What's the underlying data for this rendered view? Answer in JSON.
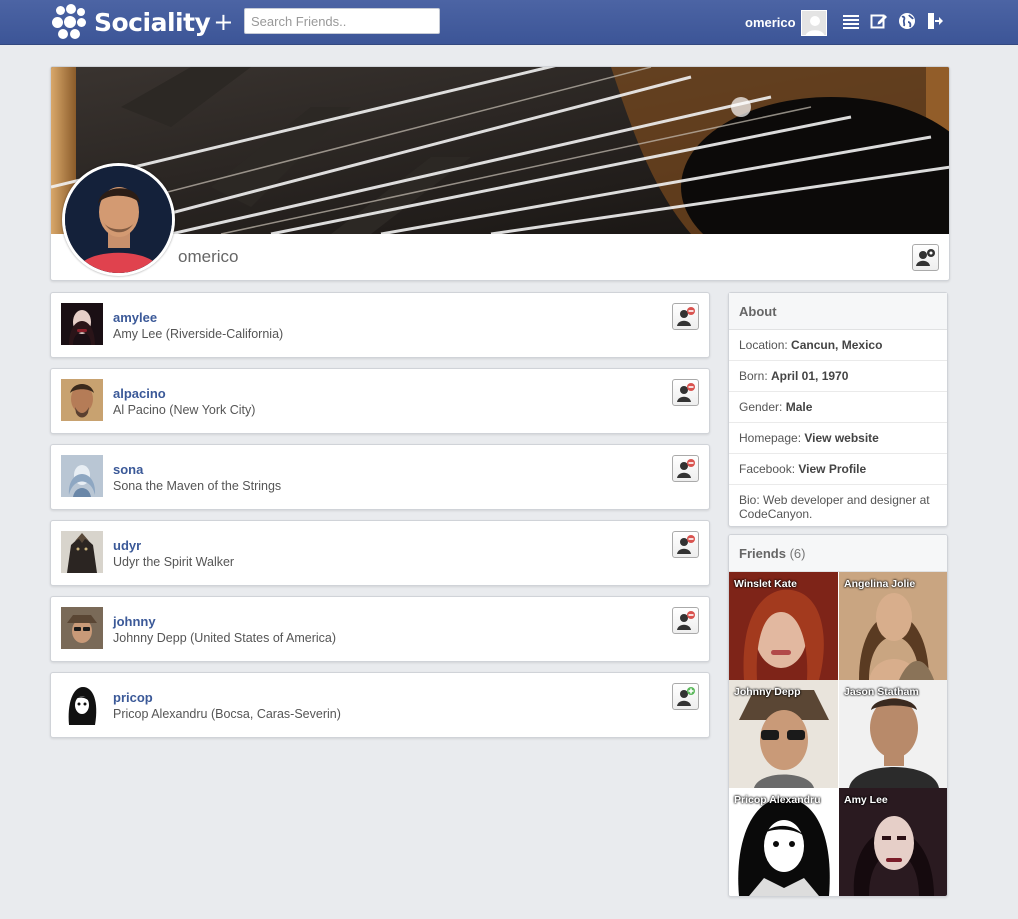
{
  "header": {
    "brand": "Sociality",
    "brand_plus": "+",
    "search_placeholder": "Search Friends..",
    "username": "omerico",
    "icons": [
      "list-icon",
      "edit-icon",
      "globe-icon",
      "logout-icon"
    ]
  },
  "profile": {
    "name": "omerico",
    "settings_icon": "user-gear-icon"
  },
  "friends_list": [
    {
      "username": "amylee",
      "full": "Amy Lee (Riverside-California)",
      "action": "remove-friend-icon"
    },
    {
      "username": "alpacino",
      "full": "Al Pacino (New York City)",
      "action": "remove-friend-icon"
    },
    {
      "username": "sona",
      "full": "Sona the Maven of the Strings",
      "action": "remove-friend-icon"
    },
    {
      "username": "udyr",
      "full": "Udyr the Spirit Walker",
      "action": "remove-friend-icon"
    },
    {
      "username": "johnny",
      "full": "Johnny Depp (United States of America)",
      "action": "remove-friend-icon"
    },
    {
      "username": "pricop",
      "full": "Pricop Alexandru (Bocsa, Caras-Severin)",
      "action": "add-friend-icon"
    }
  ],
  "about": {
    "title": "About",
    "location_label": "Location: ",
    "location": "Cancun, Mexico",
    "born_label": "Born: ",
    "born": "April 01, 1970",
    "gender_label": "Gender: ",
    "gender": "Male",
    "homepage_label": "Homepage: ",
    "homepage": "View website",
    "facebook_label": "Facebook: ",
    "facebook": "View Profile",
    "bio": "Bio: Web developer and designer at CodeCanyon."
  },
  "friends_panel": {
    "title": "Friends",
    "count": "(6)",
    "tiles": [
      "Winslet Kate",
      "Angelina Jolie",
      "Johnny Depp",
      "Jason Statham",
      "Pricop Alexandru",
      "Amy Lee"
    ]
  },
  "colors": {
    "topbar": "#3c5597",
    "link": "#3b5998",
    "remove_badge": "#d9534f",
    "add_badge": "#5cb85c"
  }
}
